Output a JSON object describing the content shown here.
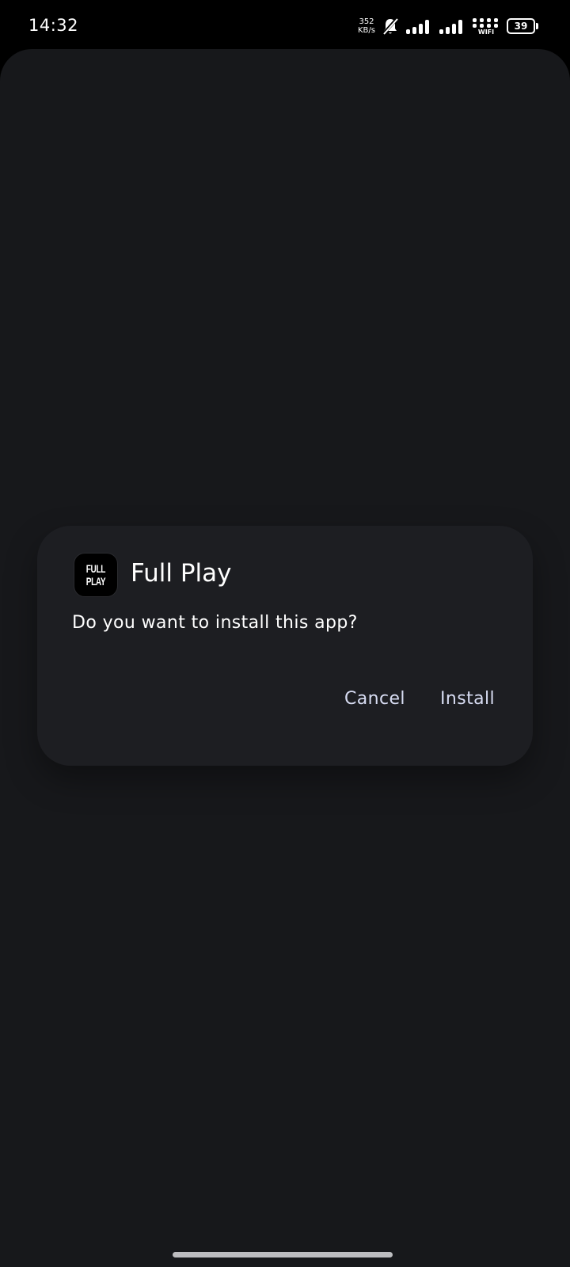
{
  "status_bar": {
    "time": "14:32",
    "net_speed_value": "352",
    "net_speed_unit": "KB/s",
    "wifi_label": "WIFI",
    "battery_level": "39",
    "icons": [
      "bell-muted-icon",
      "signal-1-icon",
      "signal-2-icon",
      "wifi-icon",
      "battery-icon"
    ]
  },
  "dialog": {
    "app_icon_line1": "FULL",
    "app_icon_line2": "PLAY",
    "app_name": "Full Play",
    "question": "Do you want to install this app?",
    "cancel_label": "Cancel",
    "install_label": "Install"
  },
  "colors": {
    "background": "#17181b",
    "dialog": "#1d1e22",
    "button_text": "#d7dcf2"
  }
}
